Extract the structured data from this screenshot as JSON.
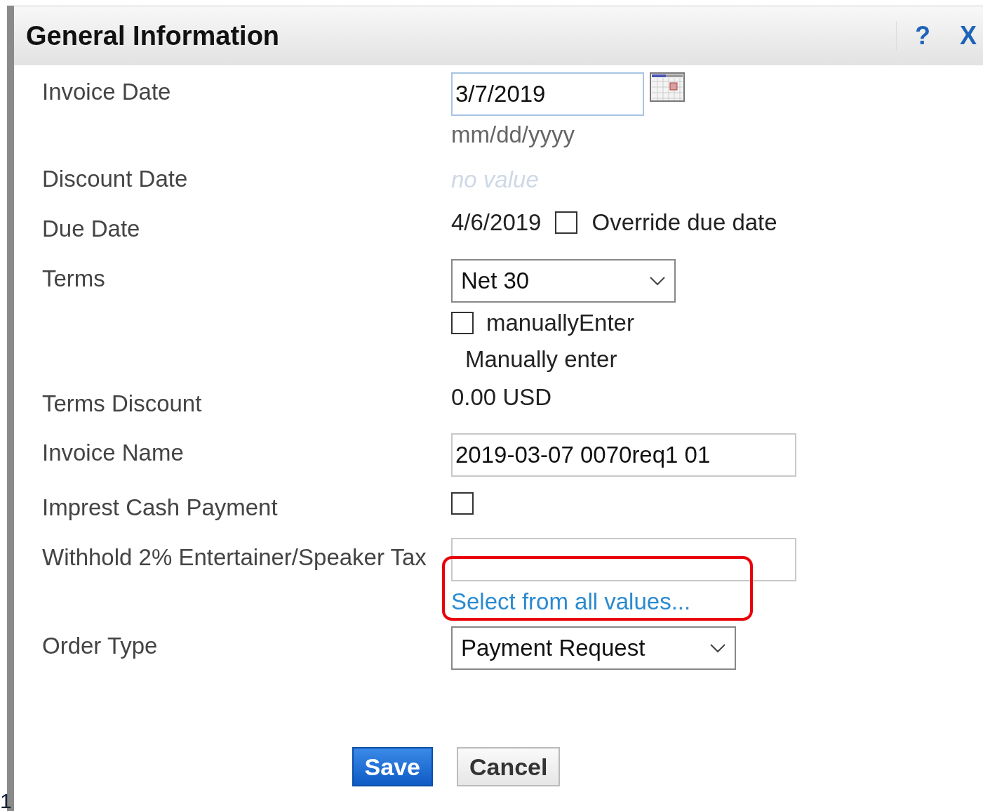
{
  "dialog": {
    "title": "General Information",
    "help": "?",
    "close": "X"
  },
  "fields": [
    {
      "kind": "date",
      "label": "Invoice Date",
      "value": "3/7/2019",
      "hint": "mm/dd/yyyy"
    },
    {
      "kind": "empty",
      "label": "Discount Date",
      "value": "no value"
    },
    {
      "kind": "due",
      "label": "Due Date",
      "value": "4/6/2019",
      "checkbox": {
        "label": "Override due date",
        "checked": false
      }
    },
    {
      "kind": "select",
      "label": "Terms",
      "value": "Net 30",
      "checkbox": {
        "label": "manuallyEnter",
        "checked": false
      },
      "note": "Manually enter"
    },
    {
      "kind": "text",
      "label": "Terms Discount",
      "value": "0.00 USD"
    },
    {
      "kind": "input",
      "label": "Invoice Name",
      "value": "2019-03-07 0070req1 01"
    },
    {
      "kind": "check",
      "label": "Imprest Cash Payment",
      "checked": false
    },
    {
      "kind": "lookup",
      "label": "Withhold 2% Entertainer/Speaker Tax",
      "link": "Select from all values...",
      "highlighted": true
    },
    {
      "kind": "select",
      "label": "Order Type",
      "value": "Payment Request"
    }
  ],
  "buttons": [
    {
      "label": "Save",
      "primary": true
    },
    {
      "label": "Cancel",
      "primary": false
    }
  ],
  "edge_text": "1"
}
